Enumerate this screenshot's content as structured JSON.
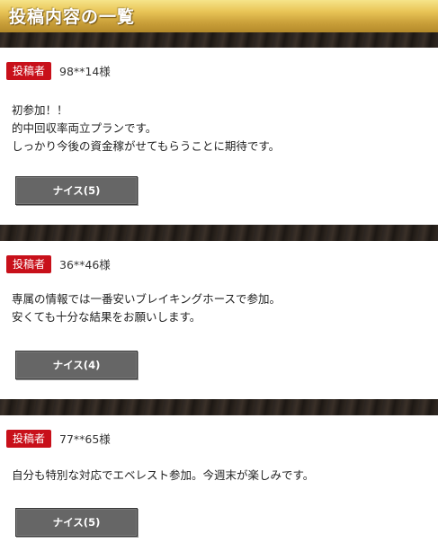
{
  "header": {
    "title": "投稿内容の一覧"
  },
  "posts": [
    {
      "badge": "投稿者",
      "user": "98**14様",
      "lines": [
        "初参加！！",
        "的中回収率両立プランです。",
        "しっかり今後の資金稼がせてもらうことに期待です。"
      ],
      "nice_label": "ナイス(5)"
    },
    {
      "badge": "投稿者",
      "user": "36**46様",
      "lines": [
        "専属の情報では一番安いブレイキングホースで参加。",
        "安くても十分な結果をお願いします。"
      ],
      "nice_label": "ナイス(4)"
    },
    {
      "badge": "投稿者",
      "user": "77**65様",
      "lines": [
        "自分も特別な対応でエベレスト参加。今週末が楽しみです。"
      ],
      "nice_label": "ナイス(5)"
    }
  ]
}
